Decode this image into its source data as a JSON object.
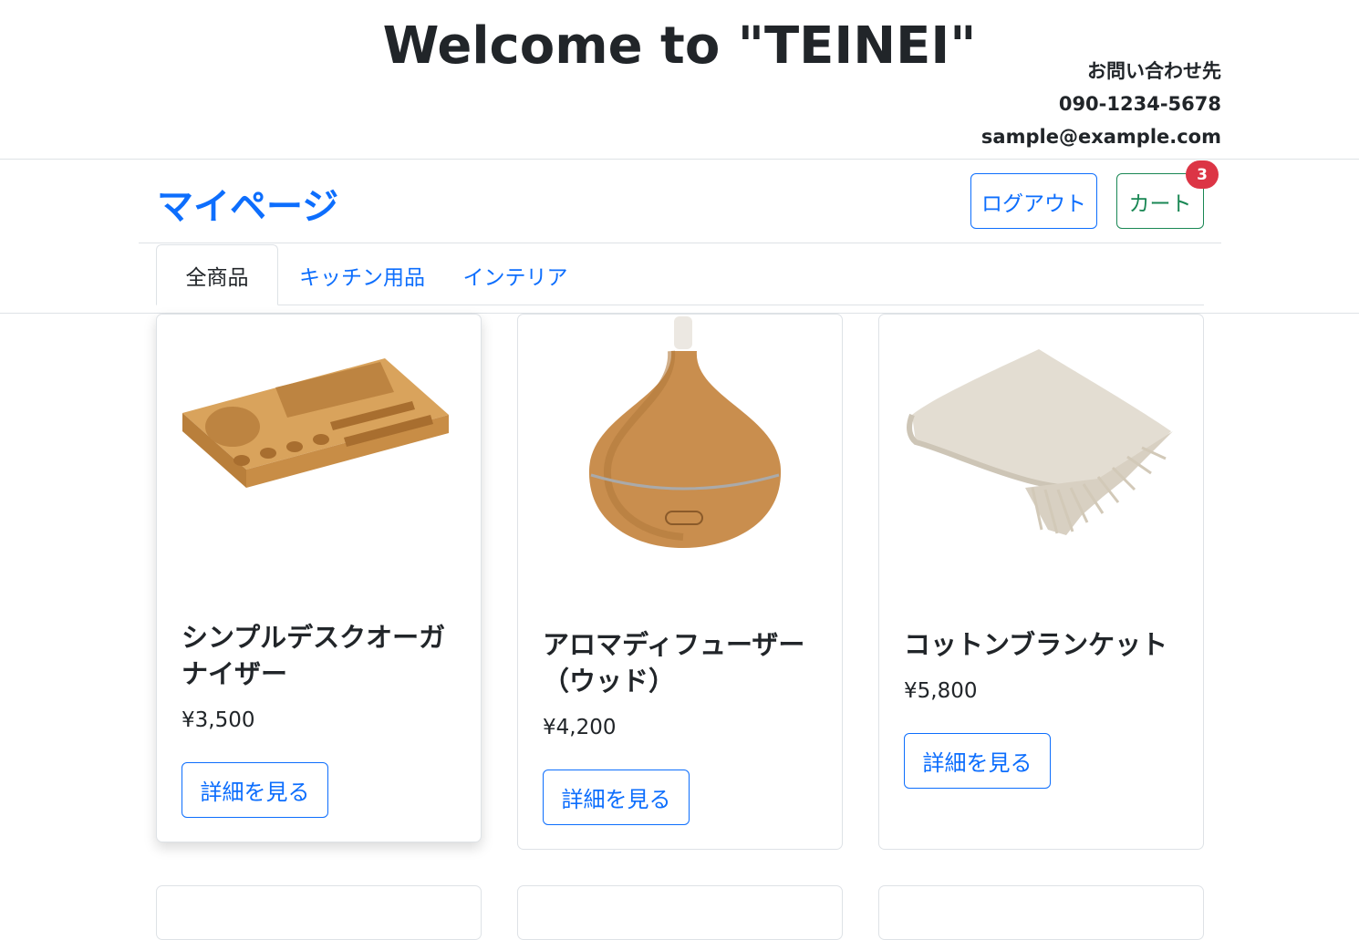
{
  "header": {
    "title": "Welcome to \"TEINEI\"",
    "contact_label": "お問い合わせ先",
    "phone": "090-1234-5678",
    "email": "sample@example.com"
  },
  "navbar": {
    "brand": "マイページ",
    "logout_label": "ログアウト",
    "cart_label": "カート",
    "cart_count": "3"
  },
  "tabs": [
    {
      "label": "全商品",
      "active": true
    },
    {
      "label": "キッチン用品",
      "active": false
    },
    {
      "label": "インテリア",
      "active": false
    }
  ],
  "products": [
    {
      "name": "シンプルデスクオーガナイザー",
      "price": "¥3,500",
      "button": "詳細を見る",
      "image": "wooden-desk-organizer"
    },
    {
      "name": "アロマディフューザー（ウッド）",
      "price": "¥4,200",
      "button": "詳細を見る",
      "image": "wood-aroma-diffuser"
    },
    {
      "name": "コットンブランケット",
      "price": "¥5,800",
      "button": "詳細を見る",
      "image": "cotton-blanket"
    }
  ],
  "colors": {
    "primary": "#0d6efd",
    "success": "#198754",
    "danger": "#dc3545",
    "border": "#dee2e6"
  }
}
